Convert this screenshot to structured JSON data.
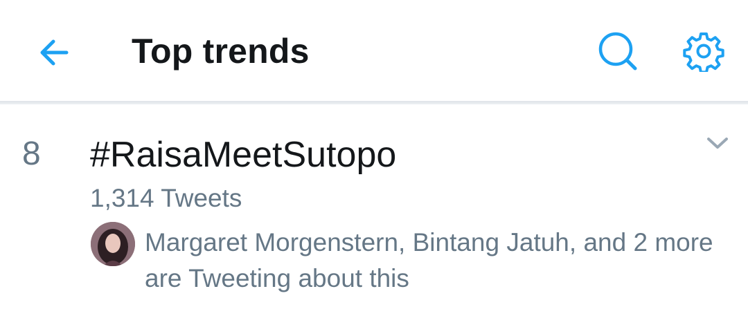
{
  "header": {
    "title": "Top trends",
    "back_icon": "back-arrow-icon",
    "search_icon": "search-icon",
    "settings_icon": "gear-icon",
    "accent_color": "#1da1f2"
  },
  "trend": {
    "rank": "8",
    "name": "#RaisaMeetSutopo",
    "tweet_count": "1,314 Tweets",
    "context": "Margaret Morgenstern, Bintang Jatuh, and 2 more are Tweeting about this",
    "menu_icon": "chevron-down-icon",
    "avatar": "avatar"
  },
  "colors": {
    "title_text": "#14171a",
    "secondary_text": "#657786",
    "divider": "#e1e8ed",
    "background": "#ffffff"
  }
}
